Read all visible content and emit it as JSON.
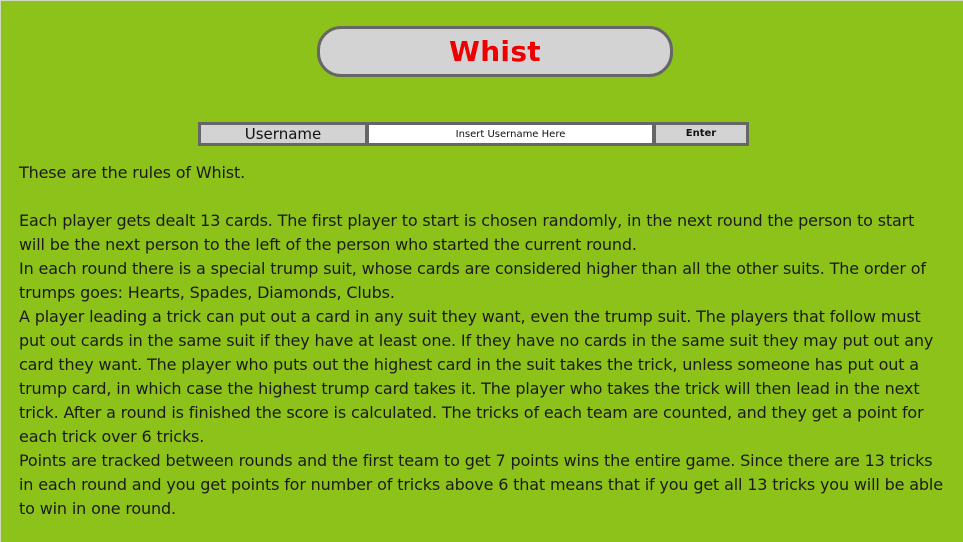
{
  "app": {
    "title": "Whist",
    "title_color": "#ee0000",
    "background_color": "#8dc21a"
  },
  "login": {
    "label": "Username",
    "placeholder": "Insert Username Here",
    "value": "",
    "button_label": "Enter"
  },
  "rules": {
    "intro": "These are the rules of Whist.",
    "paragraphs": [
      "Each player gets dealt 13 cards. The first player to start is chosen randomly, in the next round the person to start will be the next person to the left of the person who started the current round.",
      "In each round there is a special trump suit, whose cards are considered higher than all the other suits. The order of trumps goes: Hearts, Spades, Diamonds, Clubs.",
      "A player leading a trick can put out a card in any suit they want, even the trump suit. The players that follow must put out cards in the same suit if they have at least one. If they have no cards in the same suit they may put out any card they want. The player who puts out the highest card in the suit takes the trick, unless someone has put out a trump card, in which case the highest trump card takes it. The player who takes the trick will then lead in the next trick. After a round is finished the score is calculated. The tricks of each team are counted, and they get a point for each trick over 6 tricks.",
      "Points are tracked between rounds and the first team to get 7 points wins the entire game. Since there are 13 tricks in each round and you get points for number of tricks above 6 that means that if you get all 13 tricks you will be able to win in one round."
    ]
  }
}
